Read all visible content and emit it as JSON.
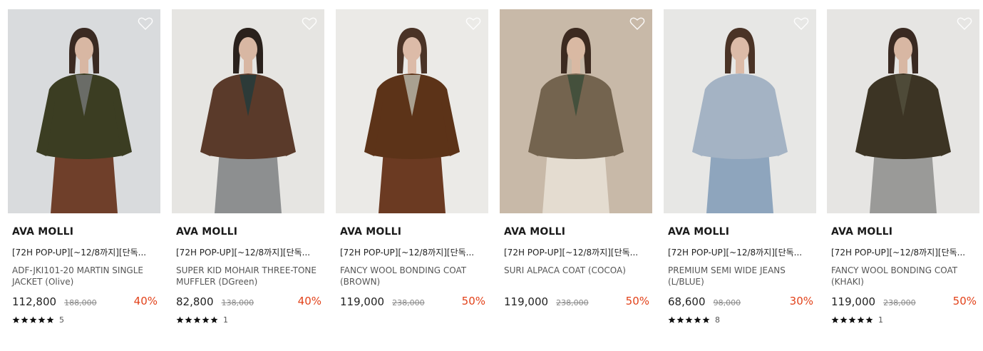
{
  "products": [
    {
      "brand": "AVA MOLLI",
      "promo": "[72H POP-UP][~12/8까지][단독...",
      "name": "ADF-JKI101-20 MARTIN SINGLE JACKET (Olive)",
      "price": "112,800",
      "original_price": "188,000",
      "discount": "40%",
      "rating_count": "5",
      "heart_icon": "heart-outline-icon",
      "palette": {
        "bg": "#d9dbdd",
        "coat": "#3b3d22",
        "inner": "#6a6c67",
        "bottom": "#6f3f2a",
        "skin": "#d8b7a3",
        "hair": "#3a2a22"
      }
    },
    {
      "brand": "AVA MOLLI",
      "promo": "[72H POP-UP][~12/8까지][단독...",
      "name": "SUPER KID MOHAIR THREE-TONE MUFFLER (DGreen)",
      "price": "82,800",
      "original_price": "138,000",
      "discount": "40%",
      "rating_count": "1",
      "heart_icon": "heart-outline-icon",
      "palette": {
        "bg": "#e6e5e2",
        "coat": "#5a3a2a",
        "inner": "#2c3a38",
        "bottom": "#8d8f90",
        "skin": "#d8b7a3",
        "hair": "#2a211c"
      }
    },
    {
      "brand": "AVA MOLLI",
      "promo": "[72H POP-UP][~12/8까지][단독...",
      "name": "FANCY WOOL BONDING COAT (BROWN)",
      "price": "119,000",
      "original_price": "238,000",
      "discount": "50%",
      "rating_count": "",
      "heart_icon": "heart-outline-icon",
      "palette": {
        "bg": "#ebeae7",
        "coat": "#5c3318",
        "inner": "#a9a090",
        "bottom": "#6b3a22",
        "skin": "#dcbba8",
        "hair": "#4a3326"
      }
    },
    {
      "brand": "AVA MOLLI",
      "promo": "[72H POP-UP][~12/8까지][단독...",
      "name": "SURI ALPACA COAT (COCOA)",
      "price": "119,000",
      "original_price": "238,000",
      "discount": "50%",
      "rating_count": "",
      "heart_icon": "heart-outline-icon",
      "palette": {
        "bg": "#c8b9a8",
        "coat": "#74644f",
        "inner": "#44503c",
        "bottom": "#e4dcd0",
        "skin": "#d9b9a3",
        "hair": "#3c2a20"
      }
    },
    {
      "brand": "AVA MOLLI",
      "promo": "[72H POP-UP][~12/8까지][단독...",
      "name": "PREMIUM SEMI WIDE JEANS (L/BLUE)",
      "price": "68,600",
      "original_price": "98,000",
      "discount": "30%",
      "rating_count": "8",
      "heart_icon": "heart-outline-icon",
      "palette": {
        "bg": "#e7e7e5",
        "coat": "#a4b3c4",
        "inner": "#a4b3c4",
        "bottom": "#8ea5bd",
        "skin": "#dcbba8",
        "hair": "#4a3326"
      }
    },
    {
      "brand": "AVA MOLLI",
      "promo": "[72H POP-UP][~12/8까지][단독...",
      "name": "FANCY WOOL BONDING COAT (KHAKI)",
      "price": "119,000",
      "original_price": "238,000",
      "discount": "50%",
      "rating_count": "1",
      "heart_icon": "heart-outline-icon",
      "palette": {
        "bg": "#e6e5e3",
        "coat": "#3c3424",
        "inner": "#4e4a38",
        "bottom": "#9a9a98",
        "skin": "#d8b7a3",
        "hair": "#3a2a22"
      }
    }
  ],
  "colors": {
    "discount": "#e2421a",
    "star": "#111111"
  },
  "rating_icon": "star-icon"
}
